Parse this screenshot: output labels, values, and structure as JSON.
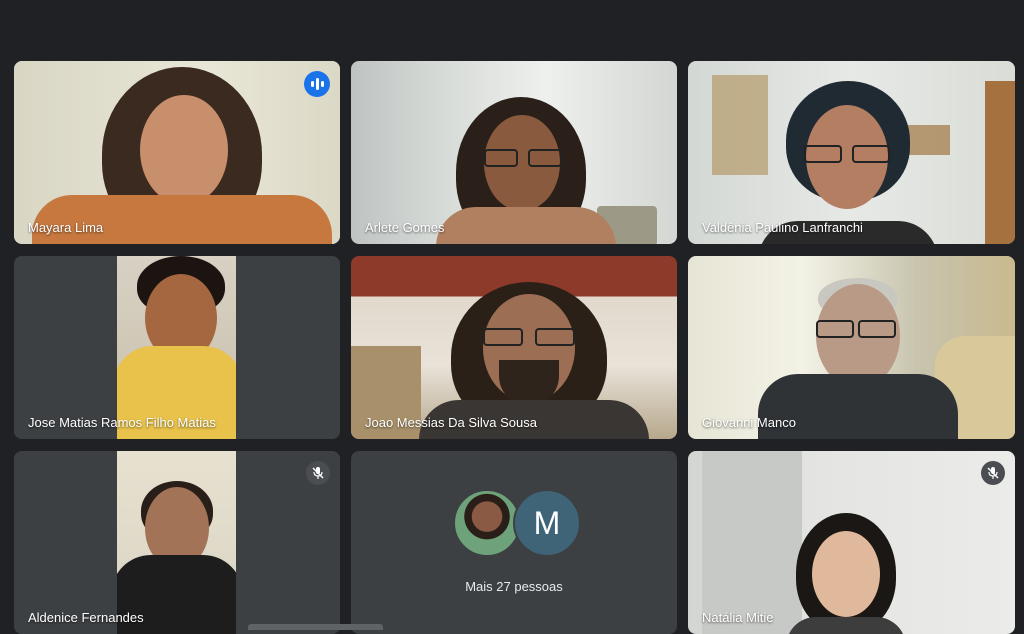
{
  "participants": [
    {
      "name": "Mayara Lima"
    },
    {
      "name": "Arlete Gomes"
    },
    {
      "name": "Valdênia Paulino Lanfranchi"
    },
    {
      "name": "Jose Matias Ramos Filho Matias"
    },
    {
      "name": "Joao Messias Da Silva Sousa"
    },
    {
      "name": "Giovanni Manco"
    },
    {
      "name": "Aldenice Fernandes"
    },
    {
      "name": "Natália Mitie"
    }
  ],
  "more_tile": {
    "avatar_letter": "M",
    "label": "Mais 27 pessoas"
  },
  "colors": {
    "background": "#202124",
    "tile": "#3c4043",
    "active_border": "#8ab4f8",
    "speaking_indicator": "#1a73e8",
    "avatar_m": "#3f6477"
  },
  "icons": {
    "speaking": "audio-level-icon",
    "muted": "mic-off-icon"
  }
}
